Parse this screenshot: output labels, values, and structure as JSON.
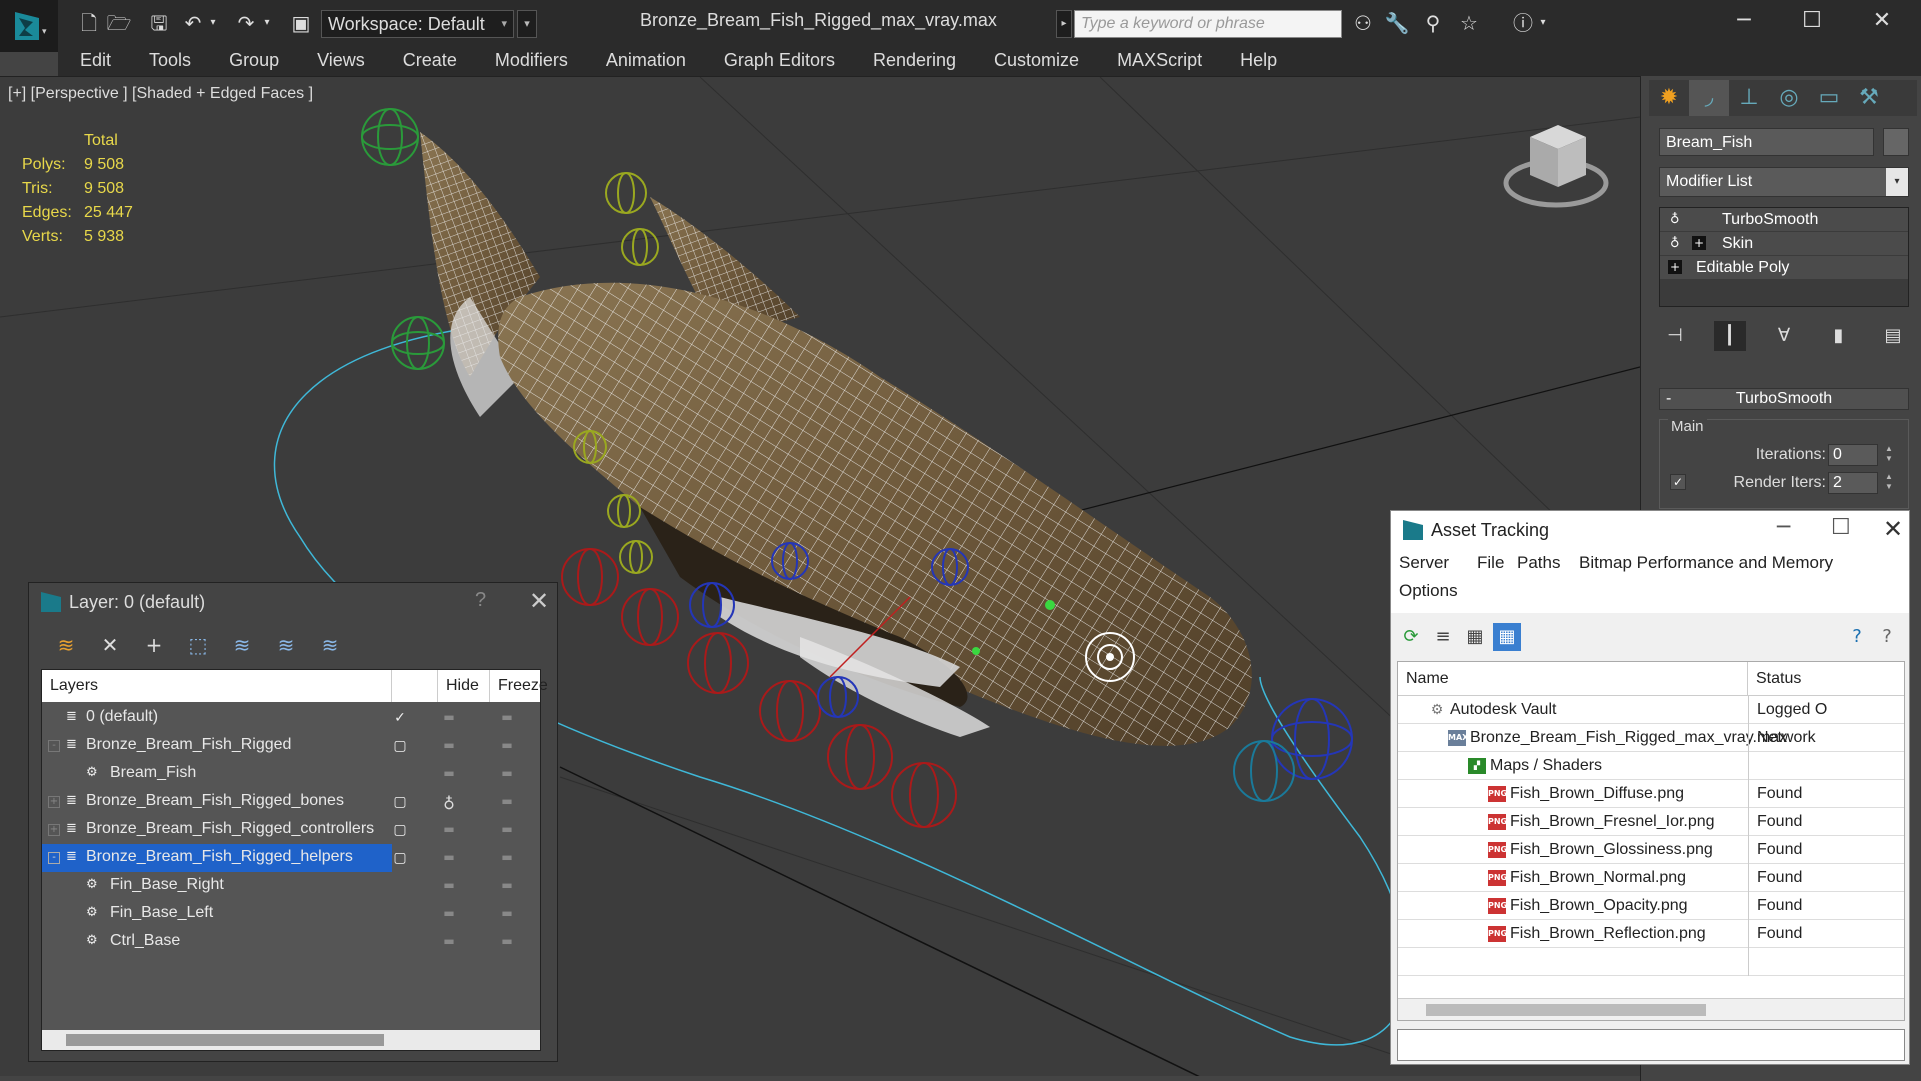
{
  "window": {
    "title": "Bronze_Bream_Fish_Rigged_max_vray.max",
    "workspace": "Workspace: Default",
    "search_placeholder": "Type a keyword or phrase"
  },
  "menu": [
    "Edit",
    "Tools",
    "Group",
    "Views",
    "Create",
    "Modifiers",
    "Animation",
    "Graph Editors",
    "Rendering",
    "Customize",
    "MAXScript",
    "Help"
  ],
  "viewport": {
    "label": "[+] [Perspective ] [Shaded + Edged Faces ]",
    "stats": {
      "header": "Total",
      "rows": [
        {
          "label": "Polys:",
          "value": "9 508"
        },
        {
          "label": "Tris:",
          "value": "9 508"
        },
        {
          "label": "Edges:",
          "value": "25 447"
        },
        {
          "label": "Verts:",
          "value": "5 938"
        }
      ]
    }
  },
  "command_panel": {
    "object_name": "Bream_Fish",
    "modifier_list": "Modifier List",
    "stack": [
      "TurboSmooth",
      "Skin",
      "Editable Poly"
    ],
    "rollout_title": "TurboSmooth",
    "group_title": "Main",
    "iterations_label": "Iterations:",
    "iterations_value": "0",
    "render_iters_label": "Render Iters:",
    "render_iters_value": "2"
  },
  "layer_dialog": {
    "title": "Layer: 0 (default)",
    "help": "?",
    "columns": {
      "layers": "Layers",
      "hide": "Hide",
      "freeze": "Freeze"
    },
    "rows": [
      {
        "name": "0 (default)"
      },
      {
        "name": "Bronze_Bream_Fish_Rigged"
      },
      {
        "name": "Bream_Fish"
      },
      {
        "name": "Bronze_Bream_Fish_Rigged_bones"
      },
      {
        "name": "Bronze_Bream_Fish_Rigged_controllers"
      },
      {
        "name": "Bronze_Bream_Fish_Rigged_helpers"
      },
      {
        "name": "Fin_Base_Right"
      },
      {
        "name": "Fin_Base_Left"
      },
      {
        "name": "Ctrl_Base"
      }
    ]
  },
  "asset_dialog": {
    "title": "Asset Tracking",
    "menu": [
      "Server",
      "File",
      "Paths",
      "Bitmap Performance and Memory",
      "Options"
    ],
    "columns": {
      "name": "Name",
      "status": "Status"
    },
    "rows": [
      {
        "name": "Autodesk Vault",
        "status": "Logged O"
      },
      {
        "name": "Bronze_Bream_Fish_Rigged_max_vray.max",
        "status": "Network"
      },
      {
        "name": "Maps / Shaders",
        "status": ""
      },
      {
        "name": "Fish_Brown_Diffuse.png",
        "status": "Found"
      },
      {
        "name": "Fish_Brown_Fresnel_Ior.png",
        "status": "Found"
      },
      {
        "name": "Fish_Brown_Glossiness.png",
        "status": "Found"
      },
      {
        "name": "Fish_Brown_Normal.png",
        "status": "Found"
      },
      {
        "name": "Fish_Brown_Opacity.png",
        "status": "Found"
      },
      {
        "name": "Fish_Brown_Reflection.png",
        "status": "Found"
      }
    ],
    "png_badge": "PNG"
  },
  "colors": {
    "accent_teal": "#1a7a8a",
    "selection_blue": "#1f62c9",
    "stats_yellow": "#e8d84a"
  }
}
